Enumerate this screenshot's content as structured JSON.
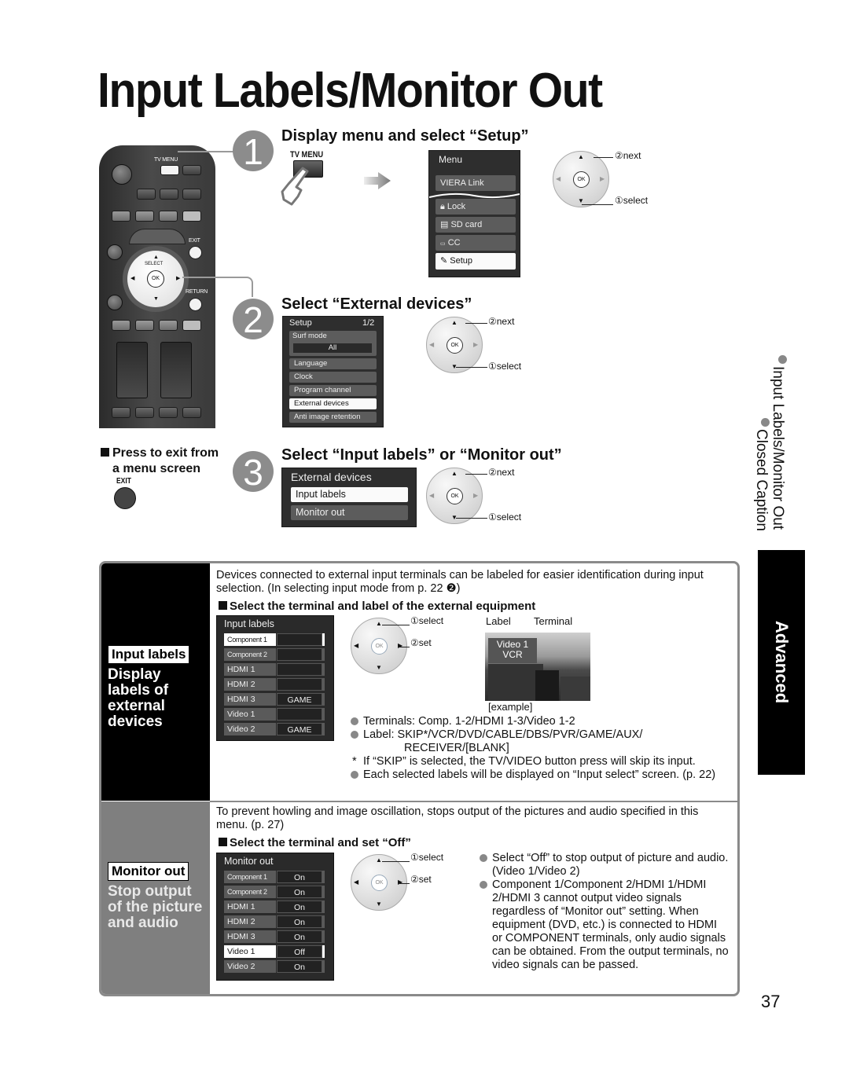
{
  "page": {
    "title": "Input Labels/Monitor Out",
    "page_number": "37"
  },
  "remote": {
    "tv_menu": "TV MENU",
    "exit": "EXIT",
    "return": "RETURN",
    "select": "SELECT",
    "ok": "OK"
  },
  "step1": {
    "number": "1",
    "heading": "Display menu and select “Setup”",
    "button_label": "TV MENU",
    "menu": {
      "title": "Menu",
      "items": [
        "VIERA Link",
        "Lock",
        "SD card",
        "CC",
        "Setup"
      ],
      "selected": "Setup"
    },
    "callouts": {
      "next": "②next",
      "select": "①select"
    }
  },
  "step2": {
    "number": "2",
    "heading": "Select “External devices”",
    "menu": {
      "title": "Setup",
      "page": "1/2",
      "surf_mode_label": "Surf mode",
      "surf_mode_value": "All",
      "items": [
        "Language",
        "Clock",
        "Program channel",
        "External devices",
        "Anti image retention"
      ],
      "selected": "External devices"
    },
    "callouts": {
      "next": "②next",
      "select": "①select"
    }
  },
  "step3": {
    "number": "3",
    "heading": "Select “Input labels” or “Monitor out”",
    "menu": {
      "title": "External devices",
      "items": [
        "Input labels",
        "Monitor out"
      ],
      "selected": "Input labels"
    },
    "callouts": {
      "next": "②next",
      "select": "①select"
    }
  },
  "exit_note": {
    "line1": "Press to exit from",
    "line2": "a menu screen",
    "button_label": "EXIT"
  },
  "side_index": {
    "items": [
      "Input Labels/Monitor Out",
      "Closed Caption"
    ],
    "tab": "Advanced"
  },
  "input_labels": {
    "badge": "Input labels",
    "description": "Display labels of external devices",
    "intro": "Devices connected to external input terminals can be labeled for easier identification during input selection. (In selecting input mode from p. 22 ❷)",
    "subheading": "Select the terminal and label of the external equipment",
    "table": {
      "title": "Input labels",
      "rows": [
        {
          "terminal": "Component 1",
          "label": ""
        },
        {
          "terminal": "Component 2",
          "label": ""
        },
        {
          "terminal": "HDMI 1",
          "label": ""
        },
        {
          "terminal": "HDMI 2",
          "label": ""
        },
        {
          "terminal": "HDMI 3",
          "label": "GAME"
        },
        {
          "terminal": "Video 1",
          "label": ""
        },
        {
          "terminal": "Video 2",
          "label": "GAME"
        }
      ],
      "selected_row": 0
    },
    "callouts": {
      "select": "①select",
      "set": "②set"
    },
    "example": {
      "label_caption": "Label",
      "terminal_caption": "Terminal",
      "terminal_value": "Video 1",
      "label_value": "VCR",
      "caption": "[example]"
    },
    "notes": [
      {
        "type": "bullet",
        "text": "Terminals:  Comp. 1-2/HDMI 1-3/Video 1-2"
      },
      {
        "type": "bullet",
        "text": "Label:  SKIP*/VCR/DVD/CABLE/DBS/PVR/GAME/AUX/"
      },
      {
        "type": "cont",
        "text": "RECEIVER/[BLANK]"
      },
      {
        "type": "star",
        "text": "If “SKIP” is selected, the TV/VIDEO button press will skip its input."
      },
      {
        "type": "bullet",
        "text": "Each selected labels will be displayed on “Input select” screen. (p. 22)"
      }
    ]
  },
  "monitor_out": {
    "badge": "Monitor out",
    "description": "Stop output of the picture and audio",
    "intro": "To prevent howling and image oscillation, stops output of the pictures and audio specified in this menu. (p. 27)",
    "subheading": "Select the terminal and set “Off”",
    "table": {
      "title": "Monitor out",
      "rows": [
        {
          "terminal": "Component 1",
          "value": "On"
        },
        {
          "terminal": "Component 2",
          "value": "On"
        },
        {
          "terminal": "HDMI 1",
          "value": "On"
        },
        {
          "terminal": "HDMI 2",
          "value": "On"
        },
        {
          "terminal": "HDMI 3",
          "value": "On"
        },
        {
          "terminal": "Video 1",
          "value": "Off"
        },
        {
          "terminal": "Video 2",
          "value": "On"
        }
      ],
      "selected_row": 5
    },
    "callouts": {
      "select": "①select",
      "set": "②set"
    },
    "notes": [
      "Select “Off” to stop output of picture and audio. (Video 1/Video 2)",
      "Component 1/Component 2/HDMI 1/HDMI 2/HDMI 3 cannot output video signals regardless of “Monitor out” setting. When equipment (DVD, etc.) is connected to HDMI or COMPONENT terminals, only audio signals can be obtained. From the output terminals, no video signals can be passed."
    ]
  }
}
